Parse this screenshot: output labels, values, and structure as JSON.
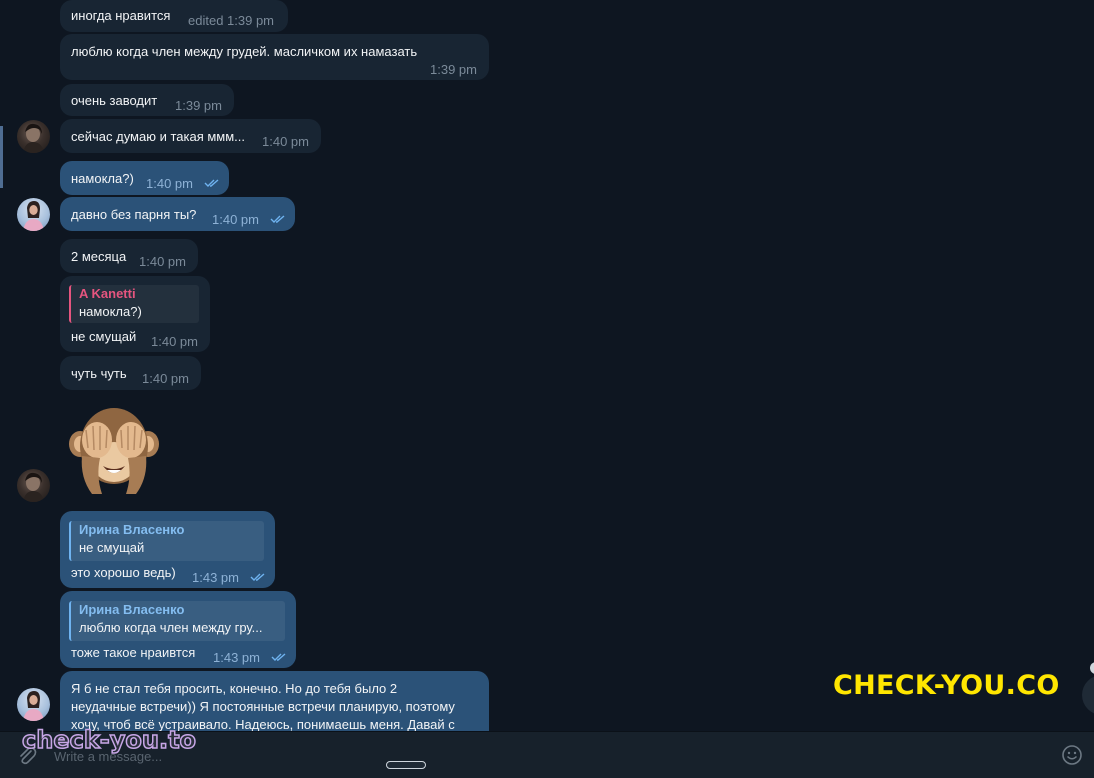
{
  "messages": [
    {
      "id": "m1",
      "dir": "in",
      "text": "иногда нравится",
      "time": "edited 1:39 pm"
    },
    {
      "id": "m2",
      "dir": "in",
      "text": "люблю когда член между грудей. масличком их намазать",
      "time": "1:39 pm"
    },
    {
      "id": "m3",
      "dir": "in",
      "text": "очень заводит",
      "time": "1:39 pm"
    },
    {
      "id": "m4",
      "dir": "in",
      "text": "сейчас думаю и такая ммм...",
      "time": "1:40 pm"
    },
    {
      "id": "m5",
      "dir": "out",
      "text": "намокла?)",
      "time": "1:40 pm"
    },
    {
      "id": "m6",
      "dir": "out",
      "text": "давно без парня ты?",
      "time": "1:40 pm"
    },
    {
      "id": "m7",
      "dir": "in",
      "text": "2 месяца",
      "time": "1:40 pm"
    },
    {
      "id": "m8",
      "dir": "in",
      "reply_name": "A Kanetti",
      "reply_text": "намокла?)",
      "text": "не смущай",
      "time": "1:40 pm"
    },
    {
      "id": "m9",
      "dir": "in",
      "text": "чуть чуть",
      "time": "1:40 pm"
    },
    {
      "id": "m10",
      "dir": "in",
      "sticker": "see-no-evil-monkey"
    },
    {
      "id": "m11",
      "dir": "out",
      "reply_name": "Ирина Власенко",
      "reply_text": "не смущай",
      "text": "это хорошо ведь)",
      "time": "1:43 pm"
    },
    {
      "id": "m12",
      "dir": "out",
      "reply_name": "Ирина Власенко",
      "reply_text": "люблю когда член между гру...",
      "text": "тоже такое нраивтся",
      "time": "1:43 pm"
    },
    {
      "id": "m13",
      "dir": "out",
      "lines": [
        "Я б не стал тебя просить, конечно. Но до тебя было 2",
        "неудачные встречи))  Я постоянные встречи планирую, поэтому",
        "хочу, чтоб всё устраивало. Надеюсь, понимаешь меня.  Давай с"
      ]
    }
  ],
  "composer": {
    "placeholder": "Write a message..."
  },
  "watermarks": {
    "right": "CHECK-YOU.CO",
    "left": "check-you.to"
  },
  "icons": [
    "attach-icon",
    "emoji-icon",
    "double-check-icon"
  ],
  "colors": {
    "background": "#0e1621",
    "incoming_bubble": "#182533",
    "outgoing_bubble": "#2b5278",
    "accent_pink": "#e5557f",
    "accent_blue": "#84bdf0",
    "watermark_yellow": "#ffe600"
  }
}
